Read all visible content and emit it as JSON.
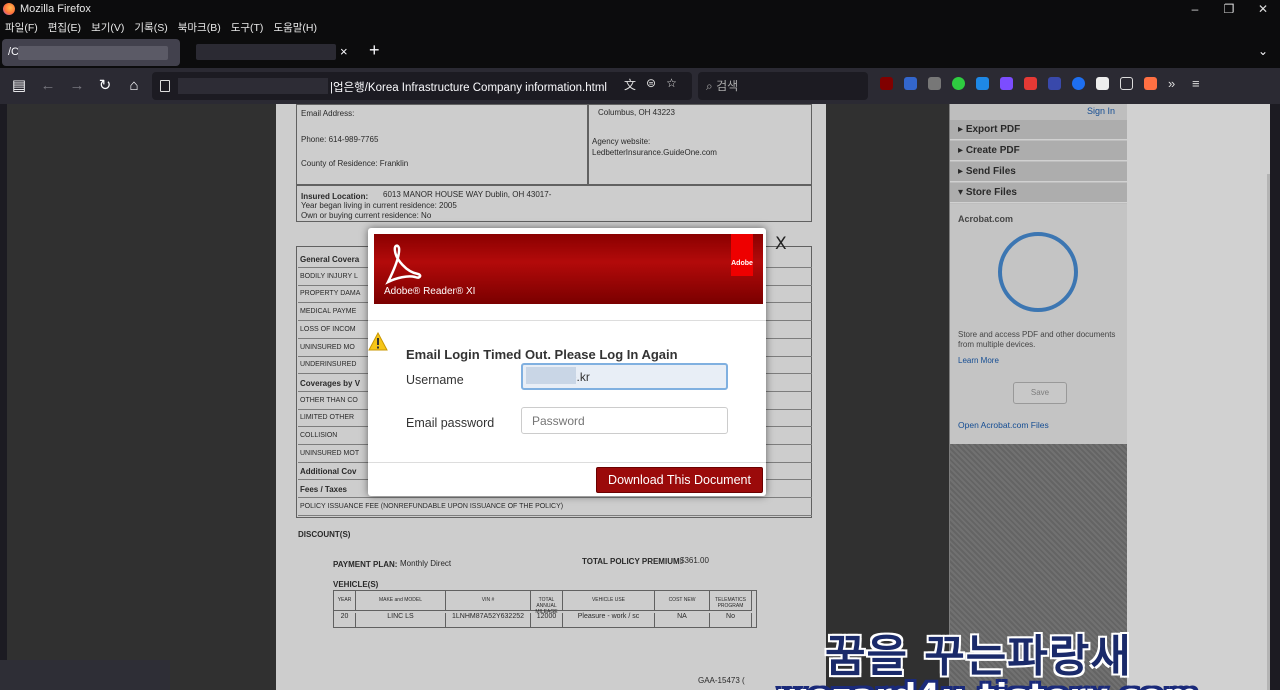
{
  "window": {
    "title": "Mozilla Firefox",
    "controls": [
      "–",
      "❐",
      "✕"
    ]
  },
  "menu": [
    "파일(F)",
    "편집(E)",
    "보기(V)",
    "기록(S)",
    "북마크(B)",
    "도구(T)",
    "도움말(H)"
  ],
  "tabs": {
    "active_label": "/C:",
    "new_tab": "+",
    "close": "×",
    "list": "⌄"
  },
  "nav": {
    "back": "←",
    "forward": "→",
    "reload": "↻",
    "home": "⌂",
    "sidebar": "▤"
  },
  "urlbar": {
    "url_visible": "|업은행/Korea Infrastructure Company information.html"
  },
  "search": {
    "placeholder": "검색"
  },
  "pdf": {
    "email_address": "Email Address:",
    "phone": "Phone: 614-989-7765",
    "county": "County of Residence:  Franklin",
    "city": "Columbus, OH 43223",
    "agency_website_label": "Agency website:",
    "agency_website": "LedbetterInsurance.GuideOne.com",
    "insured_location_label": "Insured Location:",
    "insured_location": "6013 MANOR HOUSE WAY Dublin, OH 43017-",
    "year_began": "Year began living in current residence:    2005",
    "own_buying": "Own or buying current residence:    No",
    "rows": [
      {
        "label": "General Covera",
        "bold": true
      },
      {
        "label": "BODILY INJURY L",
        "bold": false
      },
      {
        "label": "PROPERTY DAMA",
        "bold": false
      },
      {
        "label": "MEDICAL PAYME",
        "bold": false
      },
      {
        "label": "LOSS OF INCOM",
        "bold": false
      },
      {
        "label": "UNINSURED MO",
        "bold": false
      },
      {
        "label": "UNDERINSURED",
        "bold": false
      },
      {
        "label": "Coverages by V",
        "bold": true
      },
      {
        "label": "OTHER THAN CO",
        "bold": false
      },
      {
        "label": "LIMITED OTHER",
        "bold": false
      },
      {
        "label": "COLLISION",
        "bold": false
      },
      {
        "label": "UNINSURED MOT",
        "bold": false
      },
      {
        "label": "Additional Cov",
        "bold": true
      },
      {
        "label": "Fees / Taxes",
        "bold": true
      },
      {
        "label": "POLICY ISSUANCE FEE (NONREFUNDABLE UPON ISSUANCE OF THE POLICY)",
        "bold": false
      }
    ],
    "discounts": "DISCOUNT(S)",
    "payment_plan_label": "PAYMENT PLAN:",
    "payment_plan": "Monthly Direct",
    "total_premium_label": "TOTAL POLICY PREMIUM:",
    "total_premium": "$361.00",
    "vehicles_label": "VEHICLE(S)",
    "vehicle_headers": [
      "YEAR",
      "MAKE and MODEL",
      "VIN #",
      "TOTAL ANNUAL MILEAGE",
      "VEHICLE USE",
      "COST NEW",
      "TELEMATICS PROGRAM"
    ],
    "vehicle_row": [
      "20",
      "LINC LS",
      "1LNHM87A52Y632252",
      "12000",
      "Pleasure - work / sc",
      "NA",
      "No"
    ],
    "footer_code": "GAA-15473 ("
  },
  "sidepanel": {
    "sign_in": "Sign In",
    "items": [
      "Export PDF",
      "Create PDF",
      "Send Files",
      "Store Files"
    ],
    "brand": "Acrobat.com",
    "desc": "Store and access PDF and other documents from multiple devices.",
    "learn_more": "Learn More",
    "save": "Save",
    "open_files": "Open Acrobat.com Files"
  },
  "modal": {
    "product": "Adobe® Reader® XI",
    "badge": "Adobe",
    "close": "X",
    "heading": "Email Login Timed Out. Please Log In Again",
    "username_label": "Username",
    "username_value": "@ibk.co.kr",
    "password_label": "Email password",
    "password_placeholder": "Password",
    "download_button": "Download This Document"
  },
  "watermark": {
    "line1": "꿈을 꾸는파랑새",
    "line2": "wezard4u.tistory.com"
  },
  "colors": {
    "banner_red": "#9b0a0a",
    "link_blue": "#1a5fb4",
    "chrome_dark": "#2b2a33"
  }
}
